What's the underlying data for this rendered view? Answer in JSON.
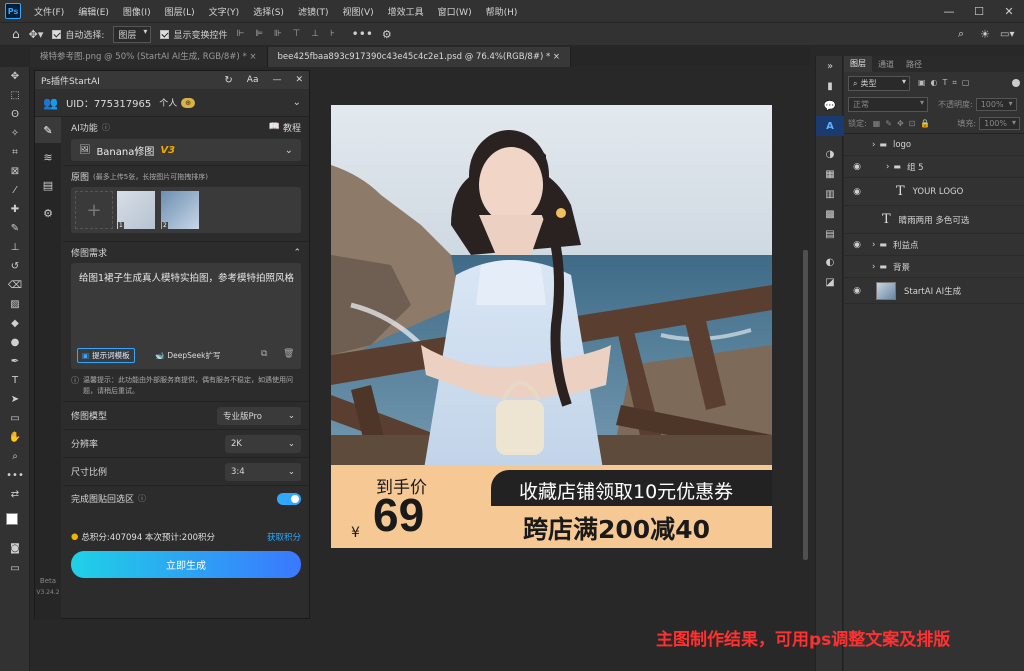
{
  "menu": {
    "items": [
      "文件(F)",
      "编辑(E)",
      "图像(I)",
      "图层(L)",
      "文字(Y)",
      "选择(S)",
      "滤镜(T)",
      "视图(V)",
      "增效工具",
      "窗口(W)",
      "帮助(H)"
    ],
    "ps_logo": "Ps",
    "win_min": "—",
    "win_max": "☐",
    "win_close": "✕"
  },
  "options": {
    "auto_select_label": "自动选择:",
    "auto_select_value": "图层",
    "show_transform_label": "显示变换控件"
  },
  "tabs": [
    {
      "label": "模特参考图.png @ 50% (StartAI AI生成, RGB/8#) *  ×"
    },
    {
      "label": "bee425fbaa893c917390c43e45c4c2e1.psd @ 76.4%(RGB/8#) *  ×"
    }
  ],
  "plugin": {
    "title": "Ps插件StartAI",
    "aa": "Aa",
    "uid_label": "UID：775317965",
    "account_type": "个人",
    "ai_func_label": "AI功能",
    "tutorial_label": "教程",
    "model_select": "Banana修图",
    "model_version": "V3",
    "source_label": "原图",
    "source_hint": "(最多上传5张，长按图片可拖拽排序)",
    "thumb1_index": "1",
    "thumb2_index": "2",
    "requirement_label": "修图需求",
    "requirement_text": "给图1裙子生成真人模特实拍图，参考模特拍照风格",
    "prompt_template_btn": "提示词模板",
    "deepseek_btn": "DeepSeek扩写",
    "notice": "温馨提示：此功能由外部服务商提供，偶有服务不稳定，如遇使用问题，请稍后重试。",
    "model_label": "修图模型",
    "model_value": "专业版Pro",
    "resolution_label": "分辨率",
    "resolution_value": "2K",
    "ratio_label": "尺寸比例",
    "ratio_value": "3:4",
    "paste_back_label": "完成图贴回选区",
    "credits_text": "总积分:407094  本次预计:200积分",
    "get_credits": "获取积分",
    "generate_btn": "立即生成",
    "beta_label": "Beta",
    "version_label": "V3.24.2"
  },
  "artwork": {
    "price_label": "到手价",
    "currency": "¥",
    "price": "69",
    "coupon_text": "收藏店铺领取10元优惠券",
    "promo_text": "跨店满200减40"
  },
  "layers_panel": {
    "tabs": [
      "图层",
      "通道",
      "路径"
    ],
    "kind_label": "类型",
    "blend_mode": "正常",
    "opacity_label": "不透明度:",
    "opacity_value": "100%",
    "lock_label": "锁定:",
    "fill_label": "填充:",
    "fill_value": "100%",
    "layers": [
      {
        "name": "logo",
        "type": "group",
        "visible": false,
        "indent": 0
      },
      {
        "name": "组 5",
        "type": "group",
        "visible": true,
        "indent": 1
      },
      {
        "name": "YOUR LOGO",
        "type": "text",
        "visible": true,
        "indent": 1
      },
      {
        "name": "睛雨两用 多色可选",
        "type": "text",
        "visible": false,
        "indent": 0
      },
      {
        "name": "利益点",
        "type": "group",
        "visible": true,
        "indent": 0
      },
      {
        "name": "背景",
        "type": "group",
        "visible": false,
        "indent": 0
      },
      {
        "name": "StartAI AI生成",
        "type": "image",
        "visible": true,
        "indent": 0
      }
    ]
  },
  "caption": "主图制作结果，可用ps调整文案及排版",
  "colors": {
    "accent": "#31a8ff",
    "caption": "#ff3030",
    "banner": "#f6c894",
    "price_text": "#1a1a1a"
  }
}
